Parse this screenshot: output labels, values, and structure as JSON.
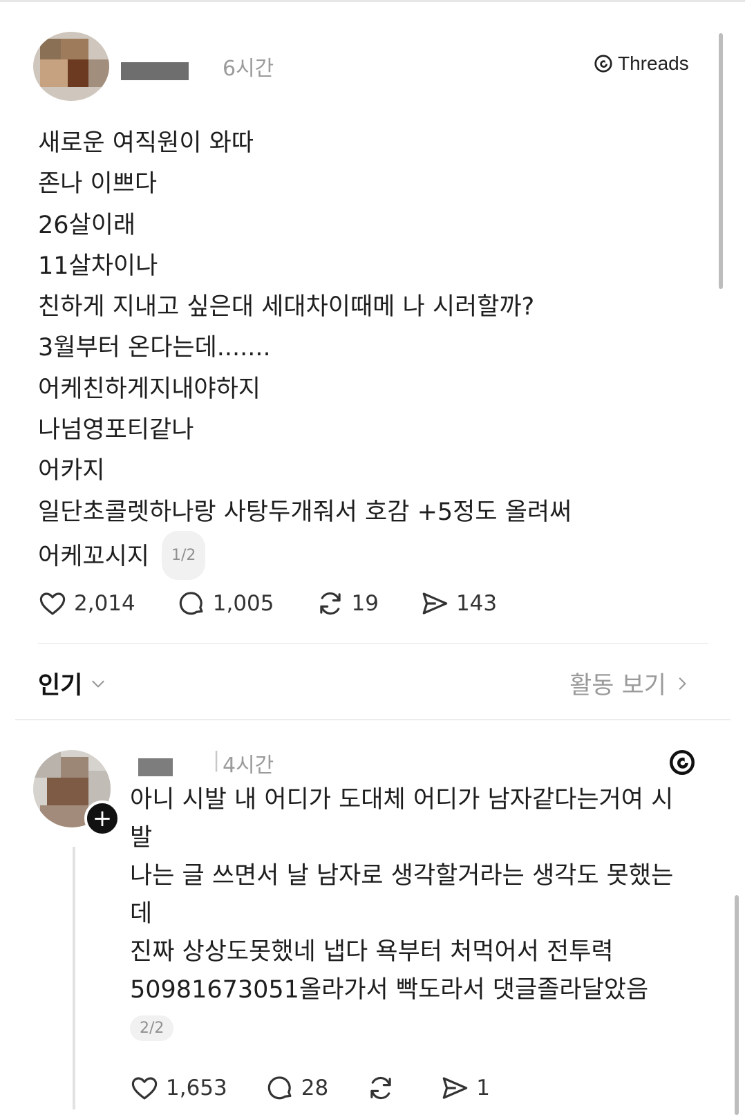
{
  "post": {
    "time": "6시간",
    "brand_label": "Threads",
    "lines": [
      "새로운 여직원이 와따",
      "존나 이쁘다",
      "26살이래",
      "11살차이나",
      "친하게 지내고 싶은대 세대차이때메 나 시러할까?",
      "3월부터 온다는데.......",
      "어케친하게지내야하지",
      "나넘영포티같나",
      "어카지",
      "일단초콜렛하나랑 사탕두개줘서 호감 +5정도 올려써",
      "어케꼬시지"
    ],
    "page_indicator": "1/2",
    "stats": {
      "likes": "2,014",
      "comments": "1,005",
      "reposts": "19",
      "shares": "143"
    }
  },
  "sort": {
    "label": "인기",
    "activity_label": "활동 보기"
  },
  "reply": {
    "time": "4시간",
    "lines": [
      "아니 시발 내 어디가 도대체 어디가 남자같다는거여 시",
      "발",
      "나는 글 쓰면서 날 남자로 생각할거라는 생각도 못했는",
      "데",
      "진짜 상상도못했네 냅다 욕부터 처먹어서 전투력",
      "50981673051올라가서 빡도라서 댓글졸라달았음"
    ],
    "page_indicator": "2/2",
    "stats": {
      "likes": "1,653",
      "comments": "28",
      "reposts": "",
      "shares": "1"
    }
  },
  "icons": {
    "like": "heart-icon",
    "comment": "comment-bubble-icon",
    "repost": "repost-icon",
    "share": "send-icon",
    "threads_logo": "threads-logo-icon",
    "chevron_down": "chevron-down-icon",
    "chevron_right": "chevron-right-icon",
    "follow": "plus-icon"
  },
  "colors": {
    "text": "#1e1e1e",
    "muted": "#9b9b9b",
    "divider": "#e4e4e4",
    "badge": "#111111"
  }
}
